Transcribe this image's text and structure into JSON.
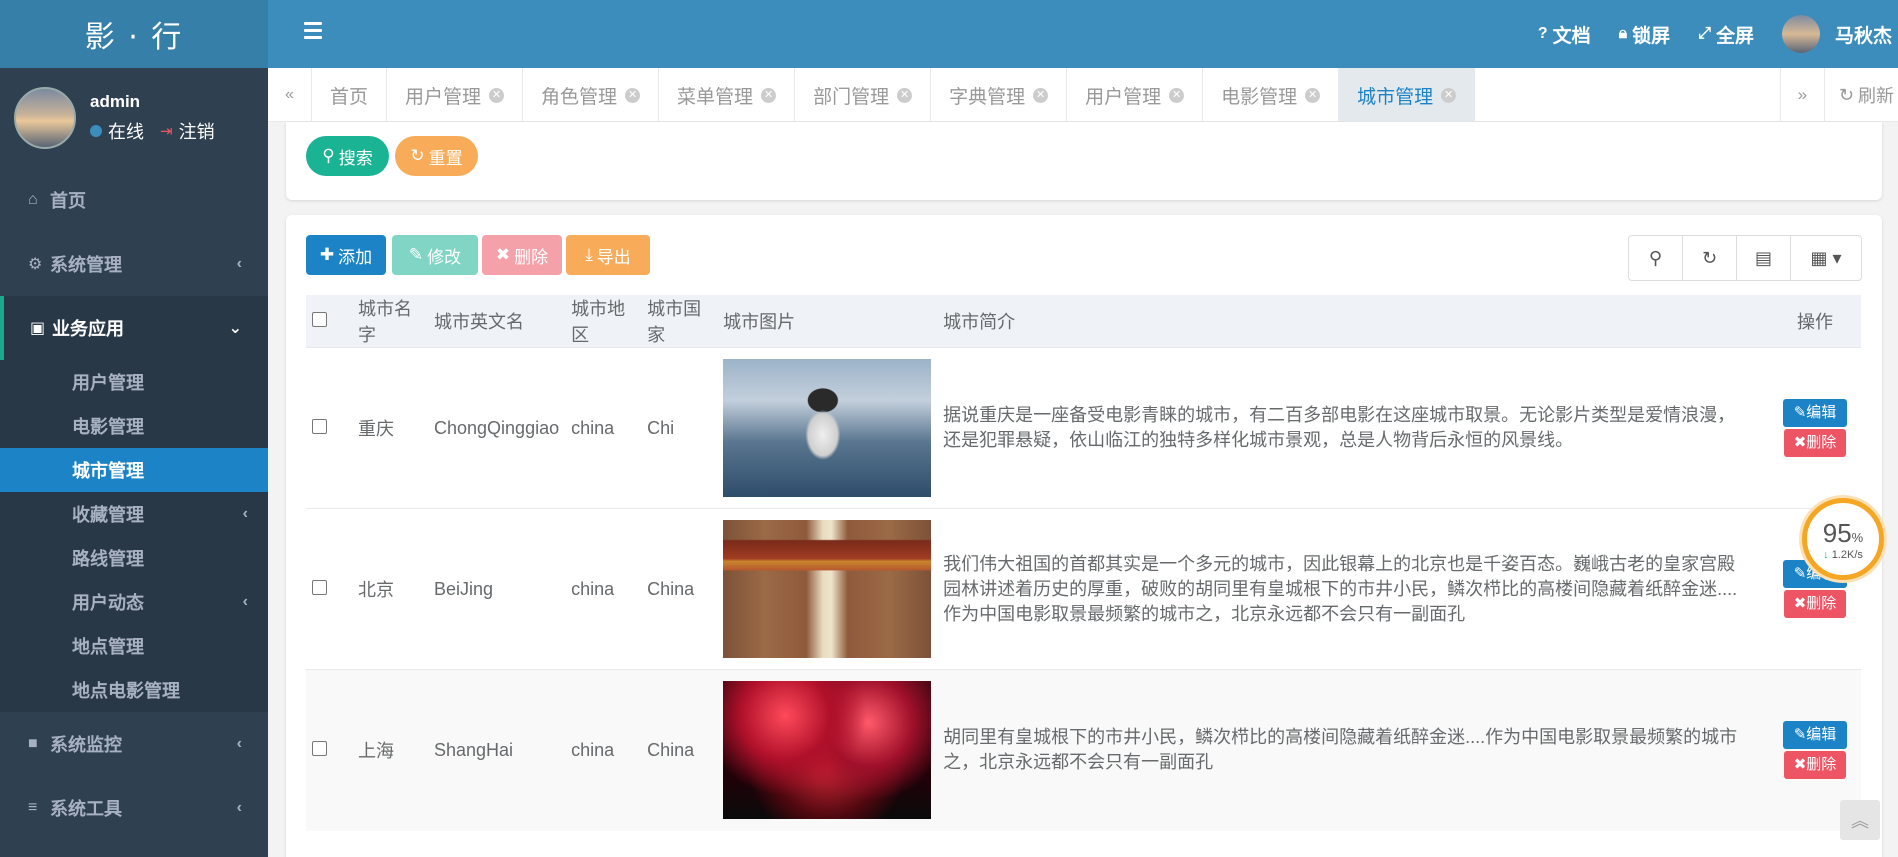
{
  "app": {
    "logo": "影 · 行"
  },
  "user": {
    "name": "admin",
    "status": "在线",
    "logout": "注销"
  },
  "sidebar": {
    "items": [
      {
        "label": "首页"
      },
      {
        "label": "系统管理"
      },
      {
        "label": "业务应用"
      },
      {
        "label": "系统监控"
      },
      {
        "label": "系统工具"
      }
    ],
    "sub_items": [
      {
        "label": "用户管理"
      },
      {
        "label": "电影管理"
      },
      {
        "label": "城市管理"
      },
      {
        "label": "收藏管理"
      },
      {
        "label": "路线管理"
      },
      {
        "label": "用户动态"
      },
      {
        "label": "地点管理"
      },
      {
        "label": "地点电影管理"
      }
    ]
  },
  "topbar": {
    "docs": "文档",
    "lock": "锁屏",
    "fullscreen": "全屏",
    "username": "马秋杰"
  },
  "tabs": [
    {
      "label": "首页"
    },
    {
      "label": "用户管理"
    },
    {
      "label": "角色管理"
    },
    {
      "label": "菜单管理"
    },
    {
      "label": "部门管理"
    },
    {
      "label": "字典管理"
    },
    {
      "label": "用户管理"
    },
    {
      "label": "电影管理"
    },
    {
      "label": "城市管理"
    }
  ],
  "tab_refresh": "刷新",
  "search_panel": {
    "search": "搜索",
    "reset": "重置"
  },
  "toolbar": {
    "add": "添加",
    "edit": "修改",
    "delete": "删除",
    "export": "导出"
  },
  "table": {
    "headers": {
      "name": "城市名字",
      "en_name": "城市英文名",
      "region": "城市地区",
      "country": "城市国家",
      "image": "城市图片",
      "intro": "城市简介",
      "ops": "操作"
    },
    "rows": [
      {
        "name": "重庆",
        "en_name": "ChongQinggiao",
        "region": "china",
        "country": "Chi",
        "intro": "据说重庆是一座备受电影青睐的城市，有二百多部电影在这座城市取景。无论影片类型是爱情浪漫，还是犯罪悬疑，依山临江的独特多样化城市景观，总是人物背后永恒的风景线。",
        "edit": "编辑",
        "delete": "删除"
      },
      {
        "name": "北京",
        "en_name": "BeiJing",
        "region": "china",
        "country": "China",
        "intro": "我们伟大祖国的首都其实是一个多元的城市，因此银幕上的北京也是千姿百态。巍峨古老的皇家宫殿园林讲述着历史的厚重，破败的胡同里有皇城根下的市井小民，鳞次栉比的高楼间隐藏着纸醉金迷....作为中国电影取景最频繁的城市之，北京永远都不会只有一副面孔",
        "edit": "编辑",
        "delete": "删除"
      },
      {
        "name": "上海",
        "en_name": "ShangHai",
        "region": "china",
        "country": "China",
        "intro": "胡同里有皇城根下的市井小民，鳞次栉比的高楼间隐藏着纸醉金迷....作为中国电影取景最频繁的城市之，北京永远都不会只有一副面孔",
        "edit": "编辑",
        "delete": "删除"
      }
    ]
  },
  "speed_widget": {
    "percent": "95",
    "unit": "%",
    "rate": "1.2K/s"
  },
  "colors": {
    "sidebar_bg": "#2f4050",
    "topbar_bg": "#3c8dbc",
    "active_blue": "#1c84c6",
    "green": "#1ab394",
    "orange": "#f8ac59",
    "red": "#ed5565"
  }
}
